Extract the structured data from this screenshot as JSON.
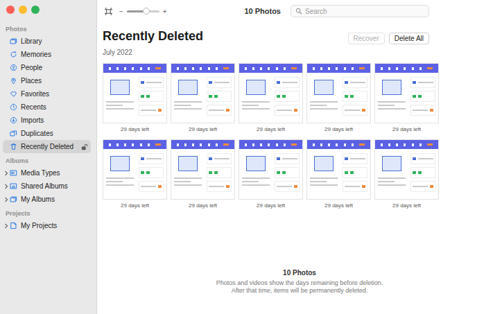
{
  "window": {
    "title": "10 Photos"
  },
  "toolbar": {
    "zoom": {
      "minus": "−",
      "plus": "+",
      "level": 0.6
    },
    "search": {
      "placeholder": "Search"
    }
  },
  "sidebar": {
    "sections": [
      {
        "title": "Photos",
        "items": [
          {
            "label": "Library",
            "selected": false,
            "kind": "plain"
          },
          {
            "label": "Memories",
            "selected": false,
            "kind": "plain"
          },
          {
            "label": "People",
            "selected": false,
            "kind": "plain"
          },
          {
            "label": "Places",
            "selected": false,
            "kind": "plain"
          },
          {
            "label": "Favorites",
            "selected": false,
            "kind": "plain"
          },
          {
            "label": "Recents",
            "selected": false,
            "kind": "plain"
          },
          {
            "label": "Imports",
            "selected": false,
            "kind": "plain"
          },
          {
            "label": "Duplicates",
            "selected": false,
            "kind": "plain"
          },
          {
            "label": "Recently Deleted",
            "selected": true,
            "kind": "lock"
          }
        ]
      },
      {
        "title": "Albums",
        "items": [
          {
            "label": "Media Types",
            "selected": false,
            "kind": "group",
            "expanded": false
          },
          {
            "label": "Shared Albums",
            "selected": false,
            "kind": "group",
            "expanded": false
          },
          {
            "label": "My Albums",
            "selected": false,
            "kind": "group",
            "expanded": false
          }
        ]
      },
      {
        "title": "Projects",
        "items": [
          {
            "label": "My Projects",
            "selected": false,
            "kind": "group",
            "expanded": false
          }
        ]
      }
    ]
  },
  "page": {
    "title": "Recently Deleted",
    "buttons": [
      {
        "label": "Recover",
        "disabled": true
      },
      {
        "label": "Delete All",
        "disabled": false
      }
    ],
    "group": "July 2022",
    "photos": [
      {
        "caption": "29 days left"
      },
      {
        "caption": "29 days left"
      },
      {
        "caption": "29 days left"
      },
      {
        "caption": "29 days left"
      },
      {
        "caption": "29 days left"
      },
      {
        "caption": "29 days left"
      },
      {
        "caption": "29 days left"
      },
      {
        "caption": "29 days left"
      },
      {
        "caption": "29 days left"
      },
      {
        "caption": "29 days left"
      }
    ]
  },
  "footer": {
    "count": "10 Photos",
    "lines": [
      "Photos and videos show the days remaining before deletion.",
      "After that time, items will be permanently deleted."
    ]
  }
}
